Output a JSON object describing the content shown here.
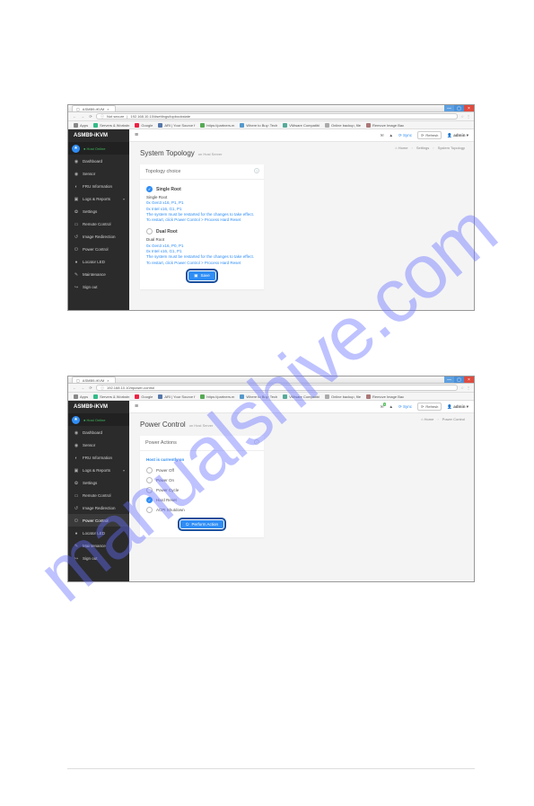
{
  "watermark": "manualshive.com",
  "browser": {
    "tab_title": "ASMB9-iKVM",
    "url_label": "Not secure",
    "url1": "192.168.10.10/#settings/topbookstate",
    "url2": "192.168.10.10/#power-control",
    "bookmarks": [
      {
        "label": "Apps"
      },
      {
        "label": "Servers & Workstn"
      },
      {
        "label": "Google"
      },
      {
        "label": "ARI | Your Source f"
      },
      {
        "label": "https://partners.m"
      },
      {
        "label": "Where to Buy: Tech"
      },
      {
        "label": "VMware Compatibi"
      },
      {
        "label": "Online backup, file"
      },
      {
        "label": "Remove Image Bac"
      }
    ]
  },
  "app": {
    "brand": "ASMB9-iKVM",
    "host_status": "Host Online",
    "nav": [
      {
        "icon": "◉",
        "label": "Dashboard"
      },
      {
        "icon": "◉",
        "label": "Sensor"
      },
      {
        "icon": "◐",
        "label": "FRU Information"
      },
      {
        "icon": "▣",
        "label": "Logs & Reports",
        "caret": true
      },
      {
        "icon": "✿",
        "label": "Settings"
      },
      {
        "icon": "▭",
        "label": "Remote Control"
      },
      {
        "icon": "↺",
        "label": "Image Redirection"
      },
      {
        "icon": "⏻",
        "label": "Power Control"
      },
      {
        "icon": "●",
        "label": "Locator LED"
      },
      {
        "icon": "✎",
        "label": "Maintenance"
      },
      {
        "icon": "↪",
        "label": "Sign out"
      }
    ],
    "topstrip": {
      "sync": "Sync",
      "refresh": "Refresh",
      "admin": "admin"
    }
  },
  "page1": {
    "title": "System Topology",
    "sub": "on Host Server",
    "crumbs": [
      "Home",
      "Settings",
      "System Topology"
    ],
    "card_title": "Topology choice",
    "single": {
      "label": "Single Root",
      "heading": "Single Root",
      "l1": "0x Gen3 x16, P1, P1",
      "l2": "0x Intel x16, G1, P1",
      "note1": "The system must be restarted for the changes to take effect.",
      "note2": "To restart, click Power Control > Process Hard Reset"
    },
    "dual": {
      "label": "Dual Root",
      "heading": "Dual Root",
      "l1": "0x Gen3 x16, P0, P1",
      "l2": "0x Intel x16, G1, P1",
      "note1": "The system must be restarted for the changes to take effect.",
      "note2": "To restart, click Power Control > Process Hard Reset"
    },
    "save": "Save"
  },
  "page2": {
    "title": "Power Control",
    "sub": "on Host Server",
    "crumbs": [
      "Home",
      "Power Control"
    ],
    "card_title": "Power Actions",
    "host_line": "Host is currently on",
    "opts": [
      "Power Off",
      "Power On",
      "Power Cycle",
      "Hard Reset",
      "ACPI Shutdown"
    ],
    "selected_index": 3,
    "perform": "Perform Action"
  }
}
